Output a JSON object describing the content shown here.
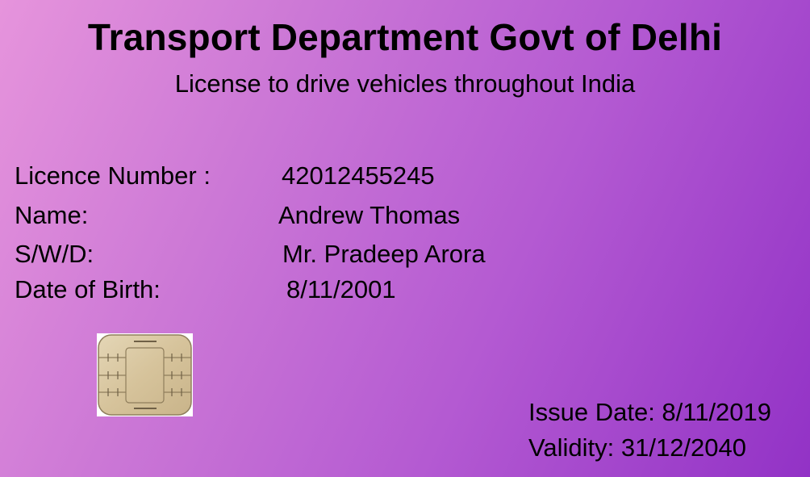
{
  "header": {
    "title": "Transport Department Govt of Delhi",
    "subtitle": "License to drive vehicles throughout India"
  },
  "details": {
    "licence_number_label": "Licence Number :",
    "licence_number_value": "42012455245",
    "name_label": "Name:",
    "name_value": "Andrew Thomas",
    "swd_label": "S/W/D:",
    "swd_value": "Mr. Pradeep Arora",
    "dob_label": "Date of Birth:",
    "dob_value": "8/11/2001"
  },
  "footer": {
    "issue_date": "Issue Date: 8/11/2019",
    "validity": "Validity: 31/12/2040"
  },
  "chip": {
    "icon": "smart-card-chip-icon"
  },
  "colors": {
    "gradient_start": "#e694dc",
    "gradient_end": "#9232c6",
    "text": "#000000",
    "chip_gold": "#d9c9a6"
  }
}
